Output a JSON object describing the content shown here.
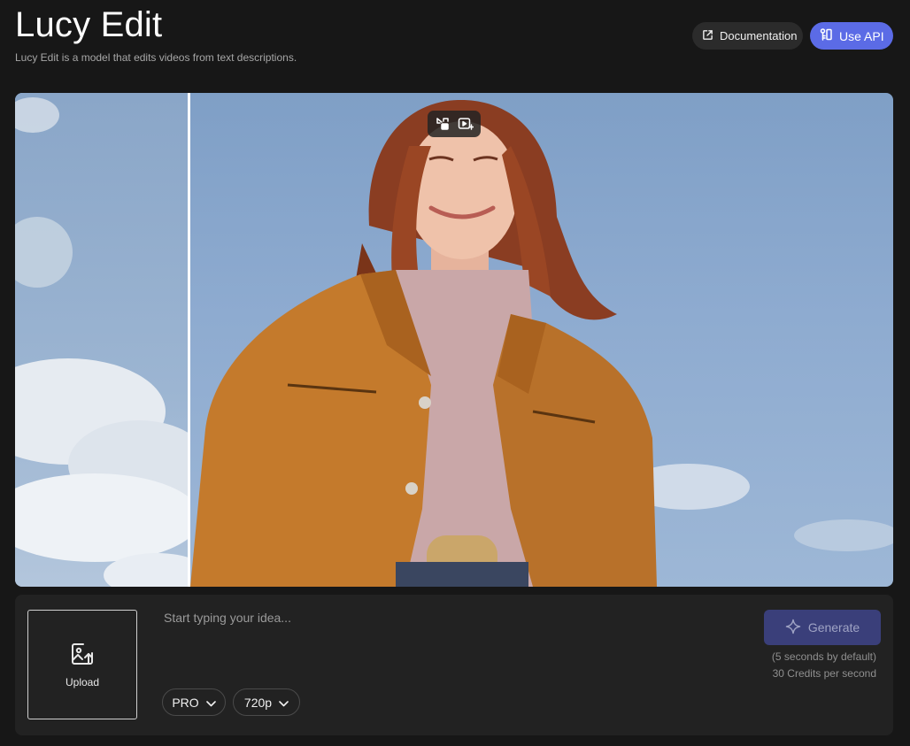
{
  "header": {
    "title": "Lucy Edit",
    "subtitle": "Lucy Edit is a model that edits videos from text descriptions.",
    "docs_button": "Documentation",
    "api_button": "Use API"
  },
  "video": {
    "toolbar_icons": [
      "swap-compare-icon",
      "play-sparkle-icon"
    ]
  },
  "editor": {
    "upload_label": "Upload",
    "prompt_placeholder": "Start typing your idea...",
    "prompt_value": "",
    "model_select": "PRO",
    "resolution_select": "720p",
    "generate_label": "Generate",
    "duration_note": "(5 seconds by default)",
    "credits_note": "30 Credits per second"
  },
  "colors": {
    "accent": "#5b6be6",
    "generate_disabled": "#3a3f7a",
    "background": "#171717",
    "panel": "#222222"
  }
}
